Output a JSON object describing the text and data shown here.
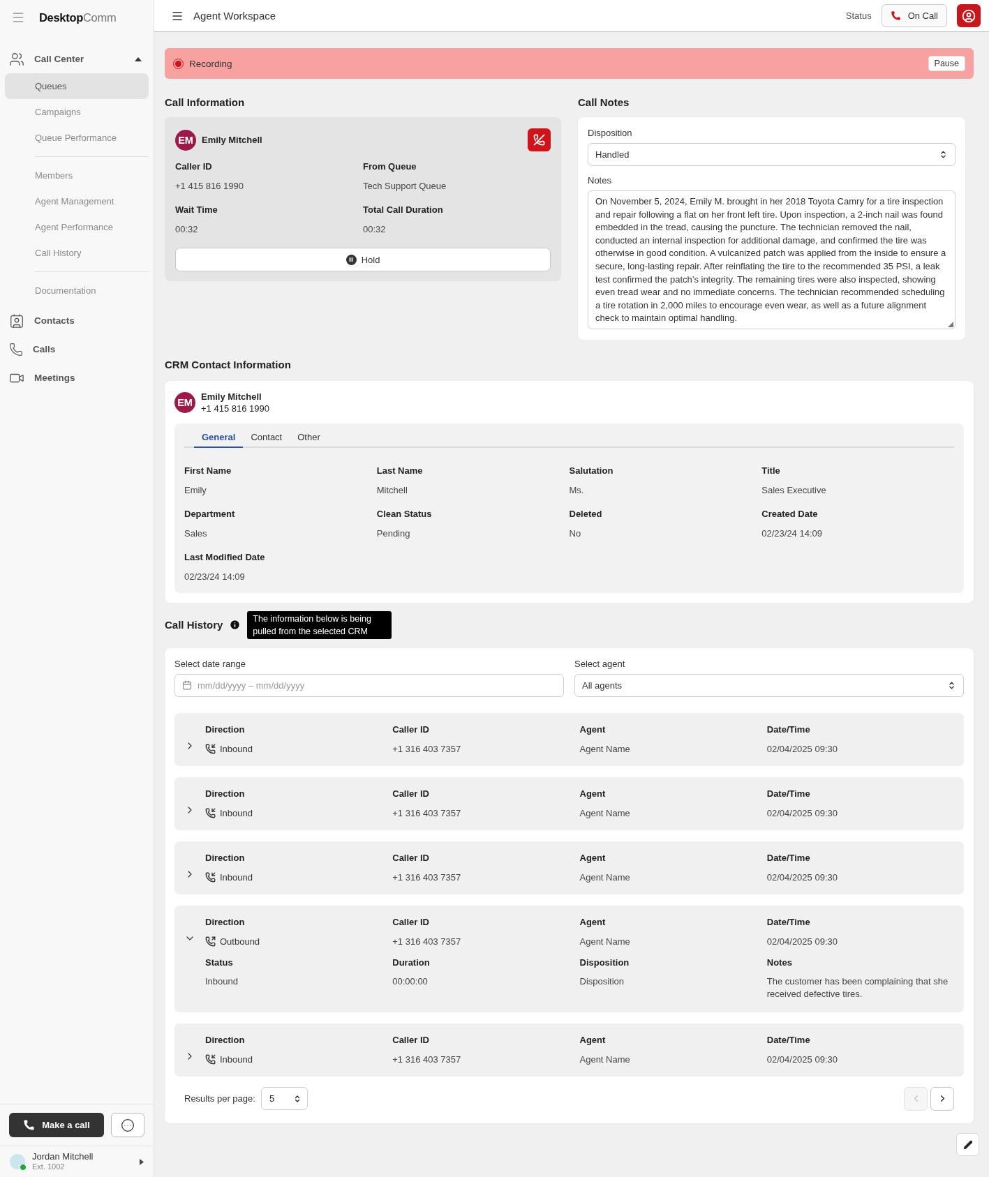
{
  "sidebar": {
    "brand": {
      "bold": "Desktop",
      "light": "Comm"
    },
    "nav": [
      {
        "label": "Call Center",
        "kind": "group",
        "expanded": true,
        "sections": [
          {
            "items": [
              {
                "label": "Queues",
                "selected": true
              },
              {
                "label": "Campaigns",
                "selected": false
              },
              {
                "label": "Queue Performance",
                "selected": false
              }
            ]
          },
          {
            "items": [
              {
                "label": "Members",
                "selected": false
              },
              {
                "label": "Agent Management",
                "selected": false
              },
              {
                "label": "Agent Performance",
                "selected": false
              },
              {
                "label": "Call History",
                "selected": false
              }
            ]
          },
          {
            "items": [
              {
                "label": "Documentation",
                "selected": false
              }
            ]
          }
        ]
      },
      {
        "label": "Contacts",
        "kind": "contacts"
      },
      {
        "label": "Calls",
        "kind": "calls"
      },
      {
        "label": "Meetings",
        "kind": "meetings"
      }
    ],
    "make_call": "Make a call",
    "user": {
      "name": "Jordan Mitchell",
      "ext": "Ext. 1002",
      "online": true
    }
  },
  "header": {
    "title": "Agent Workspace",
    "status_label": "Status",
    "status": "On Call"
  },
  "recording": {
    "label": "Recording",
    "active": true,
    "button": "Pause"
  },
  "call_info": {
    "heading": "Call Information",
    "caller": {
      "initials": "EM",
      "name": "Emily Mitchell"
    },
    "fields": [
      {
        "label": "Caller ID",
        "value": "+1 415 816 1990"
      },
      {
        "label": "From Queue",
        "value": "Tech Support Queue"
      },
      {
        "label": "Wait Time",
        "value": "00:32"
      },
      {
        "label": "Total Call Duration",
        "value": "00:32"
      }
    ],
    "hold_button": "Hold"
  },
  "call_notes": {
    "heading": "Call Notes",
    "disposition": {
      "label": "Disposition",
      "value": "Handled"
    },
    "notes": {
      "label": "Notes",
      "value": "On November 5, 2024, Emily M. brought in her 2018 Toyota Camry for a tire inspection and repair following a flat on her front left tire. Upon inspection, a 2-inch nail was found embedded in the tread, causing the puncture. The technician removed the nail, conducted an internal inspection for additional damage, and confirmed the tire was otherwise in good condition. A vulcanized patch was applied from the inside to ensure a secure, long-lasting repair. After reinflating the tire to the recommended 35 PSI, a leak test confirmed the patch’s integrity. The remaining tires were also inspected, showing even tread wear and no immediate concerns. The technician recommended scheduling a tire rotation in 2,000 miles to encourage even wear, as well as a future alignment check to maintain optimal handling."
    }
  },
  "crm": {
    "heading": "CRM Contact Information",
    "contact": {
      "initials": "EM",
      "name": "Emily Mitchell",
      "phone": "+1 415 816 1990"
    },
    "tabs": [
      {
        "label": "General",
        "selected": true
      },
      {
        "label": "Contact",
        "selected": false
      },
      {
        "label": "Other",
        "selected": false
      }
    ],
    "fields": [
      {
        "label": "First Name",
        "value": "Emily"
      },
      {
        "label": "Last Name",
        "value": "Mitchell"
      },
      {
        "label": "Salutation",
        "value": "Ms."
      },
      {
        "label": "Title",
        "value": "Sales Executive"
      },
      {
        "label": "Department",
        "value": "Sales"
      },
      {
        "label": "Clean Status",
        "value": "Pending"
      },
      {
        "label": "Deleted",
        "value": "No"
      },
      {
        "label": "Created Date",
        "value": "02/23/24 14:09"
      },
      {
        "label": "Last Modified Date",
        "value": "02/23/24 14:09"
      }
    ]
  },
  "call_history": {
    "heading": "Call History",
    "tooltip": "The information below is being pulled from the selected CRM",
    "date_range": {
      "label": "Select date range",
      "placeholder": "mm/dd/yyyy – mm/dd/yyyy"
    },
    "agent": {
      "label": "Select agent",
      "value": "All agents"
    },
    "rows": [
      {
        "expanded": false,
        "kind": "inbound",
        "fields": [
          {
            "label": "Direction",
            "value": "Inbound"
          },
          {
            "label": "Caller ID",
            "value": "+1 316 403 7357"
          },
          {
            "label": "Agent",
            "value": "Agent Name"
          },
          {
            "label": "Date/Time",
            "value": "02/04/2025 09:30"
          }
        ]
      },
      {
        "expanded": false,
        "kind": "inbound",
        "fields": [
          {
            "label": "Direction",
            "value": "Inbound"
          },
          {
            "label": "Caller ID",
            "value": "+1 316 403 7357"
          },
          {
            "label": "Agent",
            "value": "Agent Name"
          },
          {
            "label": "Date/Time",
            "value": "02/04/2025 09:30"
          }
        ]
      },
      {
        "expanded": false,
        "kind": "inbound",
        "fields": [
          {
            "label": "Direction",
            "value": "Inbound"
          },
          {
            "label": "Caller ID",
            "value": "+1 316 403 7357"
          },
          {
            "label": "Agent",
            "value": "Agent Name"
          },
          {
            "label": "Date/Time",
            "value": "02/04/2025 09:30"
          }
        ]
      },
      {
        "expanded": true,
        "kind": "outbound",
        "fields": [
          {
            "label": "Direction",
            "value": "Outbound"
          },
          {
            "label": "Caller ID",
            "value": "+1 316 403 7357"
          },
          {
            "label": "Agent",
            "value": "Agent Name"
          },
          {
            "label": "Date/Time",
            "value": "02/04/2025 09:30"
          }
        ],
        "details": [
          {
            "label": "Status",
            "value": "Inbound"
          },
          {
            "label": "Duration",
            "value": "00:00:00"
          },
          {
            "label": "Disposition",
            "value": "Disposition"
          },
          {
            "label": "Notes",
            "value": "The customer has been complaining that she received defective tires."
          }
        ]
      },
      {
        "expanded": false,
        "kind": "inbound",
        "fields": [
          {
            "label": "Direction",
            "value": "Inbound"
          },
          {
            "label": "Caller ID",
            "value": "+1 316 403 7357"
          },
          {
            "label": "Agent",
            "value": "Agent Name"
          },
          {
            "label": "Date/Time",
            "value": "02/04/2025 09:30"
          }
        ]
      }
    ],
    "results_label": "Results per page:",
    "per_page": "5",
    "pager": [
      {
        "kind": "prev",
        "disabled": true
      },
      {
        "kind": "next",
        "disabled": false
      }
    ]
  }
}
